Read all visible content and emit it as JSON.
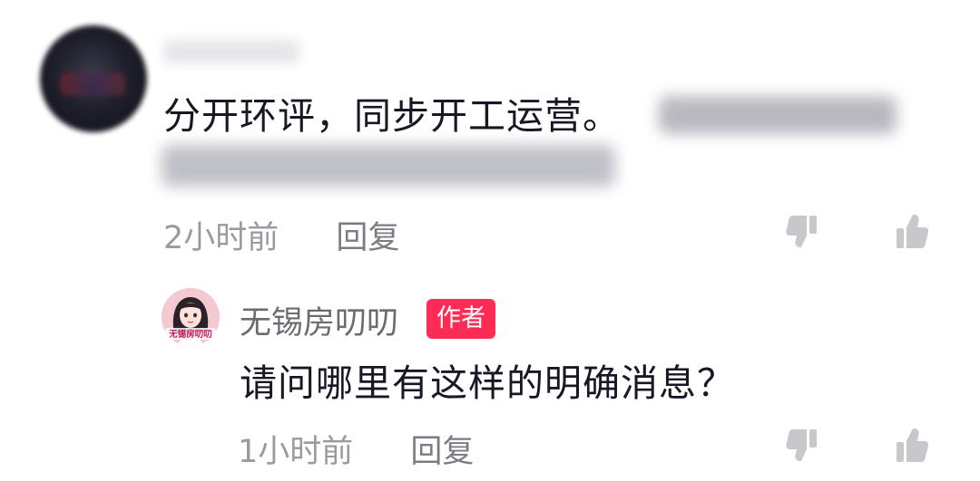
{
  "comment": {
    "text": "分开环评，同步开工运营。",
    "time": "2小时前",
    "reply_label": "回复",
    "dislike_icon": "thumbs-down-icon",
    "like_icon": "thumbs-up-icon"
  },
  "reply": {
    "author_name": "无锡房叨叨",
    "author_badge": "作者",
    "avatar_text": "无锡房叨叨",
    "text": "请问哪里有这样的明确消息？",
    "time": "1小时前",
    "reply_label": "回复",
    "dislike_icon": "thumbs-down-icon",
    "like_icon": "thumbs-up-icon"
  },
  "colors": {
    "badge": "#fe2c55",
    "text": "#161823",
    "meta": "#9a9aa2",
    "icon": "#c8c8cc"
  }
}
